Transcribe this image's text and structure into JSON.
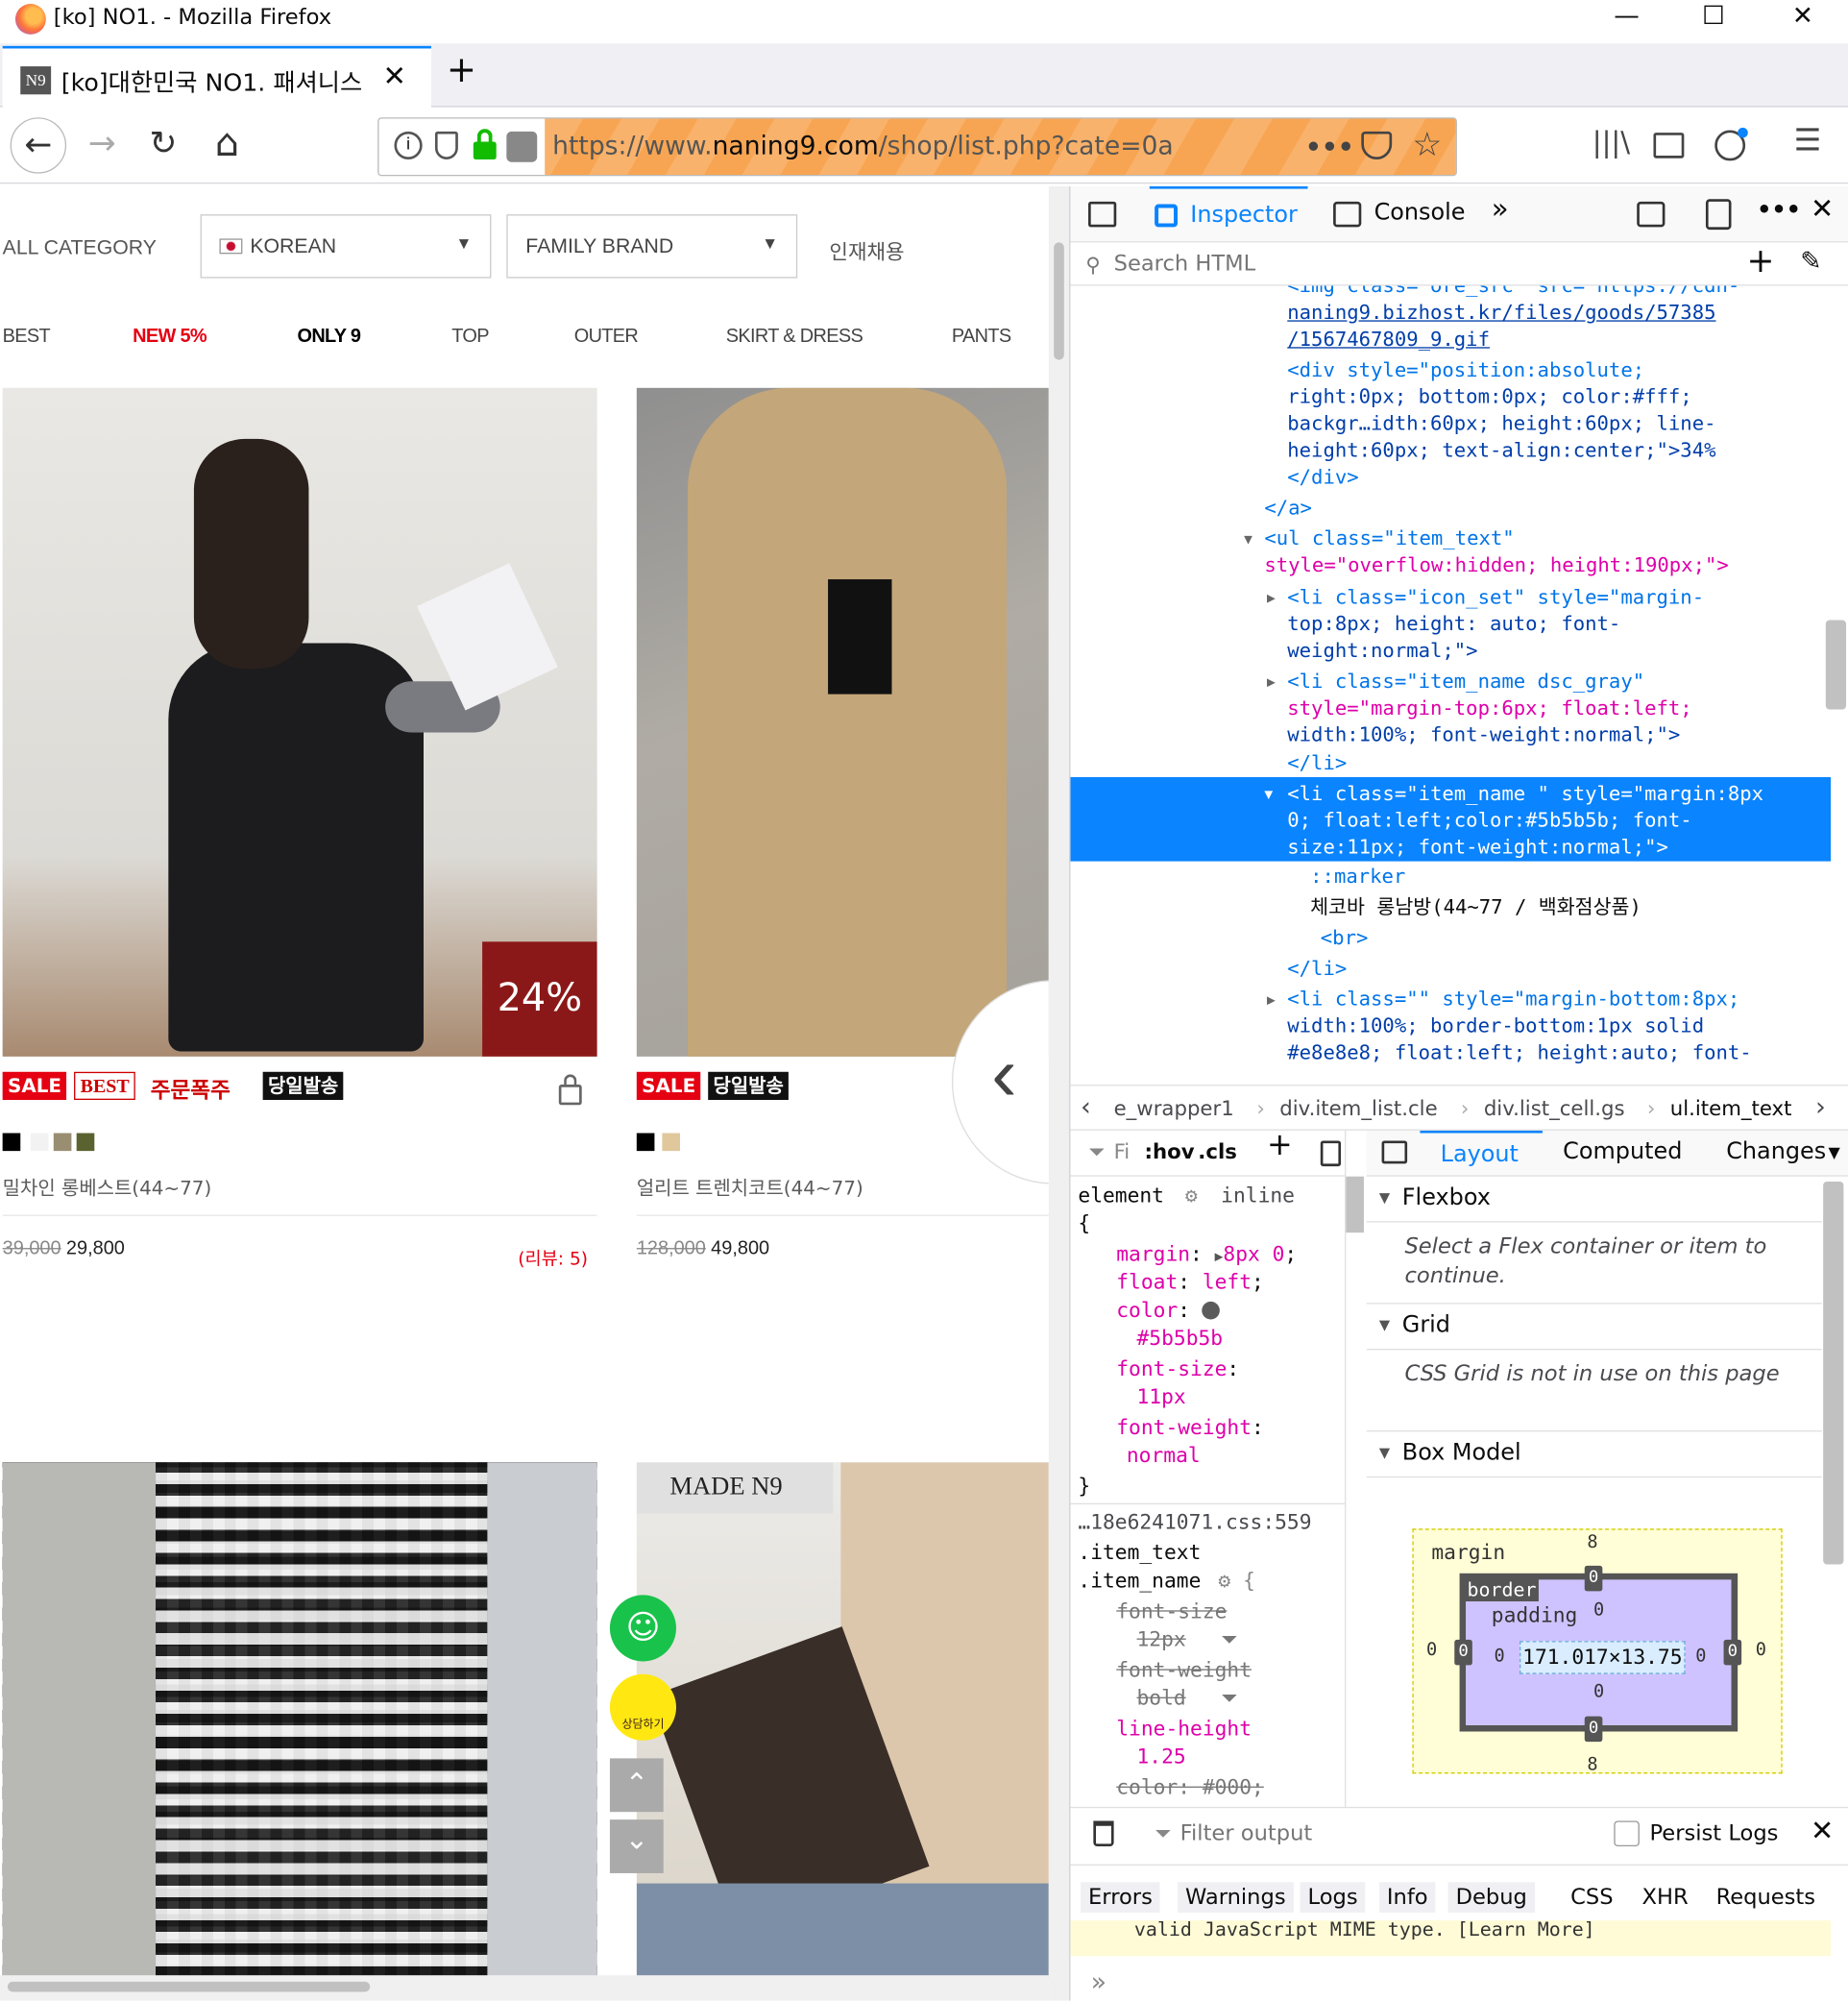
{
  "window": {
    "title": "[ko] NO1.   - Mozilla Firefox",
    "minimize": "—",
    "maximize": "☐",
    "close": "✕"
  },
  "tab": {
    "favicon": "N9",
    "title": "[ko]대한민국 NO1. 패셔니스",
    "close": "✕",
    "new_tab": "+"
  },
  "nav": {
    "back": "←",
    "forward": "→",
    "reload": "↻",
    "home": "⌂",
    "url_scheme": "https://www.",
    "url_domain": "naning9.com",
    "url_path": "/shop/list.php?cate=0a",
    "more": "•••"
  },
  "site": {
    "all_category": "ALL CATEGORY",
    "lang_select": "KOREAN",
    "brand_select": "FAMILY BRAND",
    "recruit": "인재채용",
    "menu": [
      "BEST",
      "NEW 5%",
      "ONLY 9",
      "TOP",
      "OUTER",
      "SKIRT & DRESS",
      "PANTS"
    ],
    "products": [
      {
        "discount": "24%",
        "badges": [
          "SALE",
          "BEST",
          "주문폭주",
          "당일발송"
        ],
        "name": "밀차인 롱베스트(44~77)",
        "price_old": "39,000",
        "price_new": "29,800",
        "reviews": "(리뷰: 5)"
      },
      {
        "badges": [
          "SALE",
          "당일발송"
        ],
        "name": "얼리트 트렌치코트(44~77)",
        "price_old": "128,000",
        "price_new": "49,800"
      }
    ],
    "made_label": "MADE N9",
    "talk_label": "상담하기"
  },
  "devtools": {
    "tabs": {
      "inspector": "Inspector",
      "console": "Console",
      "more": "»"
    },
    "search_placeholder": "Search HTML",
    "markup": {
      "l0": "<img class=\"ore_src\" src=\"https://cdn-",
      "l1": "naning9.bizhost.kr/files/goods/57385",
      "l2": "/1567467809_9.gif",
      "l3": "<div style=\"position:absolute;",
      "l4": "right:0px; bottom:0px; color:#fff;",
      "l5": "backgr…idth:60px; height:60px; line-",
      "l6": "height:60px; text-align:center;\">34%",
      "l7": "</div>",
      "l8": "</a>",
      "l9": "<ul class=\"item_text\"",
      "l10": "style=\"overflow:hidden; height:190px;\">",
      "l11": "<li class=\"icon_set\" style=\"margin-",
      "l12": "top:8px; height: auto; font-",
      "l13": "weight:normal;\">",
      "l14": "<li class=\"item_name dsc_gray\"",
      "l15": "style=\"margin-top:6px; float:left;",
      "l16": "width:100%; font-weight:normal;\">",
      "l17": "</li>",
      "l18": "<li class=\"item_name \" style=\"margin:8px",
      "l19": "0; float:left;color:#5b5b5b; font-",
      "l20": "size:11px; font-weight:normal;\">",
      "l21": "::marker",
      "l22": "체코바 롱남방(44~77 / 백화점상품)",
      "l23": "<br>",
      "l24": "</li>",
      "l25": "<li class=\"\" style=\"margin-bottom:8px;",
      "l26": "width:100%; border-bottom:1px solid",
      "l27": "#e8e8e8; float:left; height:auto; font-"
    },
    "breadcrumbs": [
      "e_wrapper1",
      "div.item_list.cle",
      "div.list_cell.gs",
      "ul.item_text"
    ],
    "rules": {
      "filter": "Fi",
      "hov": ":hov",
      "cls": ".cls",
      "element": "element",
      "inline": "inline",
      "decls": [
        {
          "prop": "margin",
          "val": "8px 0"
        },
        {
          "prop": "float",
          "val": "left"
        },
        {
          "prop": "color",
          "val": "#5b5b5b"
        },
        {
          "prop": "font-size",
          "val": "11px"
        },
        {
          "prop": "font-weight",
          "val": "normal"
        }
      ],
      "source": "…18e6241071.css:559",
      "selector1": ".item_text",
      "selector2": ".item_name",
      "struck": [
        {
          "prop": "font-size",
          "val": "12px"
        },
        {
          "prop": "font-weight",
          "val": "bold"
        }
      ],
      "line_height_prop": "line-height",
      "line_height_val": "1.25",
      "color_struck": "color: #000;"
    },
    "layout_tabs": [
      "Layout",
      "Computed",
      "Changes"
    ],
    "flexbox": {
      "title": "Flexbox",
      "msg": "Select a Flex container or item to continue."
    },
    "grid": {
      "title": "Grid",
      "msg": "CSS Grid is not in use on this page"
    },
    "box_model": {
      "title": "Box Model",
      "margin": "margin",
      "border": "border",
      "padding": "padding",
      "content": "171.017×13.75",
      "margin_top": "8",
      "margin_bottom": "8",
      "zero": "0"
    },
    "console": {
      "filter_placeholder": "Filter output",
      "persist": "Persist Logs",
      "levels": [
        "Errors",
        "Warnings",
        "Logs",
        "Info",
        "Debug"
      ],
      "types": [
        "CSS",
        "XHR",
        "Requests"
      ],
      "message": "valid JavaScript MIME type. [Learn More]",
      "prompt": "»"
    }
  }
}
